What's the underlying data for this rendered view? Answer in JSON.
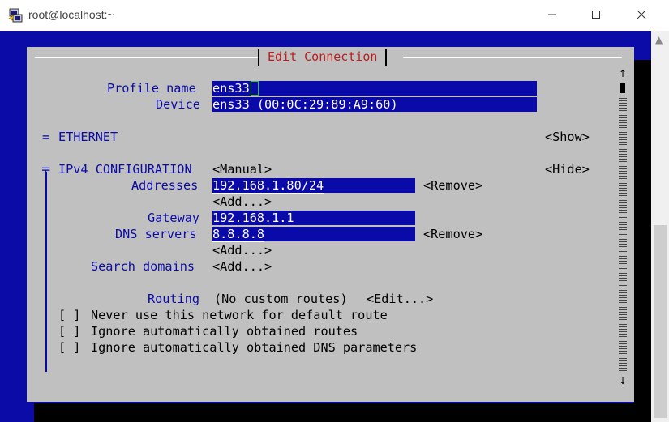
{
  "window": {
    "title": "root@localhost:~"
  },
  "dialog": {
    "title": "Edit Connection",
    "profile_name": {
      "label": "Profile name",
      "value": "ens33"
    },
    "device": {
      "label": "Device",
      "value": "ens33 (00:0C:29:89:A9:60)"
    },
    "ethernet": {
      "marker": "=",
      "label": "ETHERNET",
      "toggle": "<Show>"
    },
    "ipv4": {
      "marker": "╤",
      "label": "IPv4 CONFIGURATION",
      "mode": "<Manual>",
      "toggle": "<Hide>",
      "addresses_label": "Addresses",
      "address": "192.168.1.80/24",
      "remove_label": "<Remove>",
      "add_label": "<Add...>",
      "gateway_label": "Gateway",
      "gateway": "192.168.1.1",
      "dns_label": "DNS servers",
      "dns": "8.8.8.8",
      "search_label": "Search domains",
      "routing_label": "Routing",
      "routing_value": "(No custom routes)",
      "edit_label": "<Edit...>",
      "checkbox_mark": "[ ]",
      "check_never_default": "Never use this network for default route",
      "check_ignore_routes": "Ignore automatically obtained routes",
      "check_ignore_dns": "Ignore automatically obtained DNS parameters"
    },
    "scroll": {
      "up": "↑",
      "down": "↓"
    }
  }
}
